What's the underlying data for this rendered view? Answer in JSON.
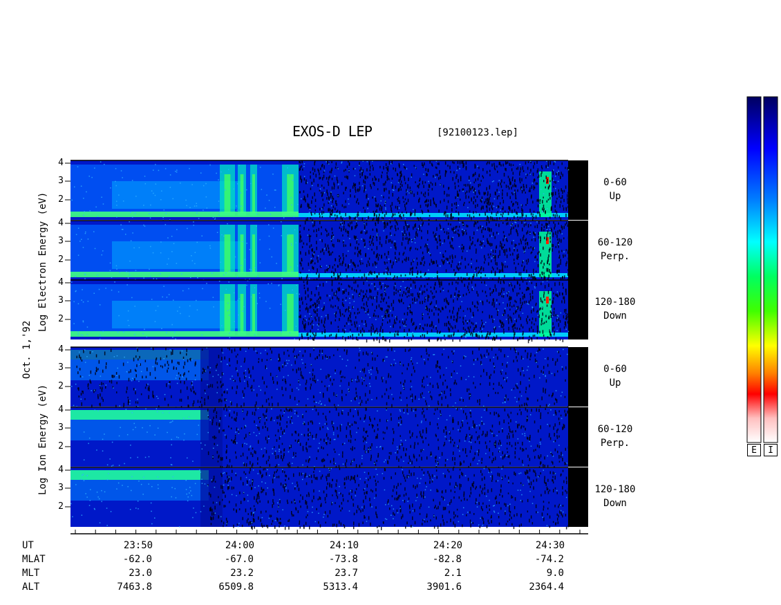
{
  "header": {
    "title": "EXOS-D LEP",
    "filename": "[92100123.lep]"
  },
  "left_labels": {
    "electron": "Log  Electron  Energy (eV)",
    "ion": "Log   Ion   Energy (eV)",
    "date": "Oct. 1,'92"
  },
  "chart_data": {
    "type": "heatmap",
    "title": "EXOS-D LEP",
    "xlabel": "UT",
    "x_ticks": [
      "23:50",
      "24:00",
      "24:10",
      "24:20",
      "24:30"
    ],
    "y_ticks": [
      "2",
      "3",
      "4"
    ],
    "panels": [
      {
        "species": "Electron",
        "pitch_range": "0-60",
        "direction": "Up"
      },
      {
        "species": "Electron",
        "pitch_range": "60-120",
        "direction": "Perp."
      },
      {
        "species": "Electron",
        "pitch_range": "120-180",
        "direction": "Down"
      },
      {
        "species": "Ion",
        "pitch_range": "0-60",
        "direction": "Up"
      },
      {
        "species": "Ion",
        "pitch_range": "60-120",
        "direction": "Perp."
      },
      {
        "species": "Ion",
        "pitch_range": "120-180",
        "direction": "Down"
      }
    ],
    "orbit_table": {
      "rows": [
        {
          "label": "UT",
          "values": [
            "23:50",
            "24:00",
            "24:10",
            "24:20",
            "24:30"
          ]
        },
        {
          "label": "MLAT",
          "values": [
            "-62.0",
            "-67.0",
            "-73.8",
            "-82.8",
            "-74.2"
          ]
        },
        {
          "label": "MLT",
          "values": [
            "23.0",
            "23.2",
            "23.7",
            "2.1",
            "9.0"
          ]
        },
        {
          "label": "ALT",
          "values": [
            "7463.8",
            "6509.8",
            "5313.4",
            "3901.6",
            "2364.4"
          ]
        }
      ]
    },
    "colorbars": [
      "E",
      "I"
    ],
    "colorscale": [
      "#000080",
      "#0000ff",
      "#0080ff",
      "#00ffff",
      "#00ff40",
      "#40ff00",
      "#ffff00",
      "#ff8000",
      "#ff0000",
      "#ffe0e0",
      "#ffffff"
    ]
  }
}
